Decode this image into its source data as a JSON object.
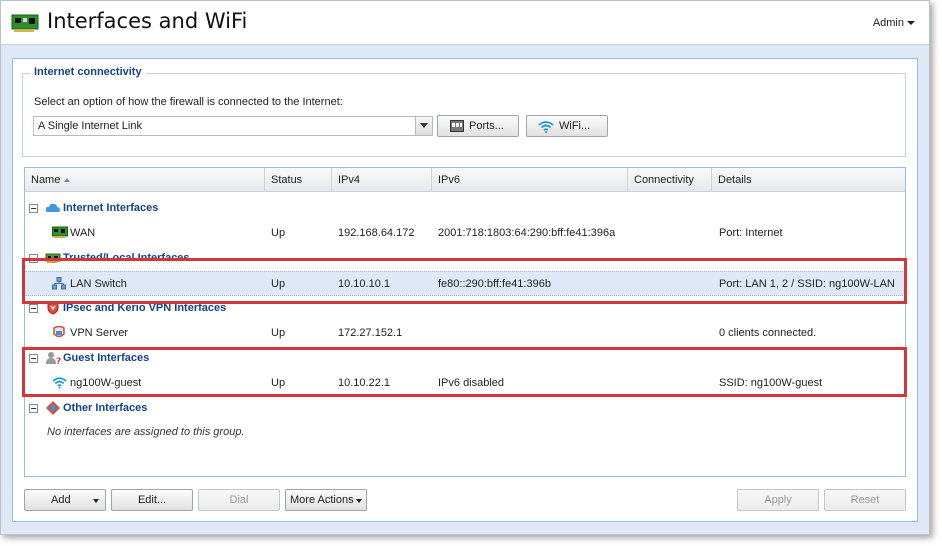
{
  "header": {
    "title": "Interfaces and WiFi",
    "user_menu": "Admin"
  },
  "connectivity": {
    "legend": "Internet connectivity",
    "prompt": "Select an option of how the firewall is connected to the Internet:",
    "mode_value": "A Single Internet Link",
    "ports_button": "Ports...",
    "wifi_button": "WiFi..."
  },
  "grid": {
    "columns": [
      "Name",
      "Status",
      "IPv4",
      "IPv6",
      "Connectivity",
      "Details"
    ],
    "sort_column": "Name",
    "groups": [
      {
        "label": "Internet Interfaces",
        "icon": "cloud-icon",
        "rows": [
          {
            "name": "WAN",
            "status": "Up",
            "ipv4": "192.168.64.172",
            "ipv6": "2001:718:1803:64:290:bff:fe41:396a",
            "connectivity": "",
            "details": "Port: Internet",
            "icon": "network-card-icon"
          }
        ]
      },
      {
        "label": "Trusted/Local Interfaces",
        "icon": "local-network-icon",
        "rows": [
          {
            "name": "LAN Switch",
            "status": "Up",
            "ipv4": "10.10.10.1",
            "ipv6": "fe80::290:bff:fe41:396b",
            "connectivity": "",
            "details": "Port: LAN 1, 2 / SSID: ng100W-LAN",
            "icon": "switch-icon"
          }
        ]
      },
      {
        "label": "IPsec and Kerio VPN Interfaces",
        "icon": "vpn-shield-icon",
        "rows": [
          {
            "name": "VPN Server",
            "status": "Up",
            "ipv4": "172.27.152.1",
            "ipv6": "",
            "connectivity": "",
            "details": "0 clients connected.",
            "icon": "vpn-server-icon"
          }
        ]
      },
      {
        "label": "Guest Interfaces",
        "icon": "guest-user-icon",
        "rows": [
          {
            "name": "ng100W-guest",
            "status": "Up",
            "ipv4": "10.10.22.1",
            "ipv6": "IPv6 disabled",
            "connectivity": "",
            "details": "SSID: ng100W-guest",
            "icon": "wifi-icon"
          }
        ]
      },
      {
        "label": "Other Interfaces",
        "icon": "other-interfaces-icon",
        "empty_note": "No interfaces are assigned to this group."
      }
    ]
  },
  "actions": {
    "add": "Add",
    "edit": "Edit...",
    "dial": "Dial",
    "more": "More Actions",
    "apply": "Apply",
    "reset": "Reset"
  },
  "colors": {
    "highlight": "#d0383c",
    "group_text": "#15428b",
    "selection": "#dfe8f6"
  }
}
